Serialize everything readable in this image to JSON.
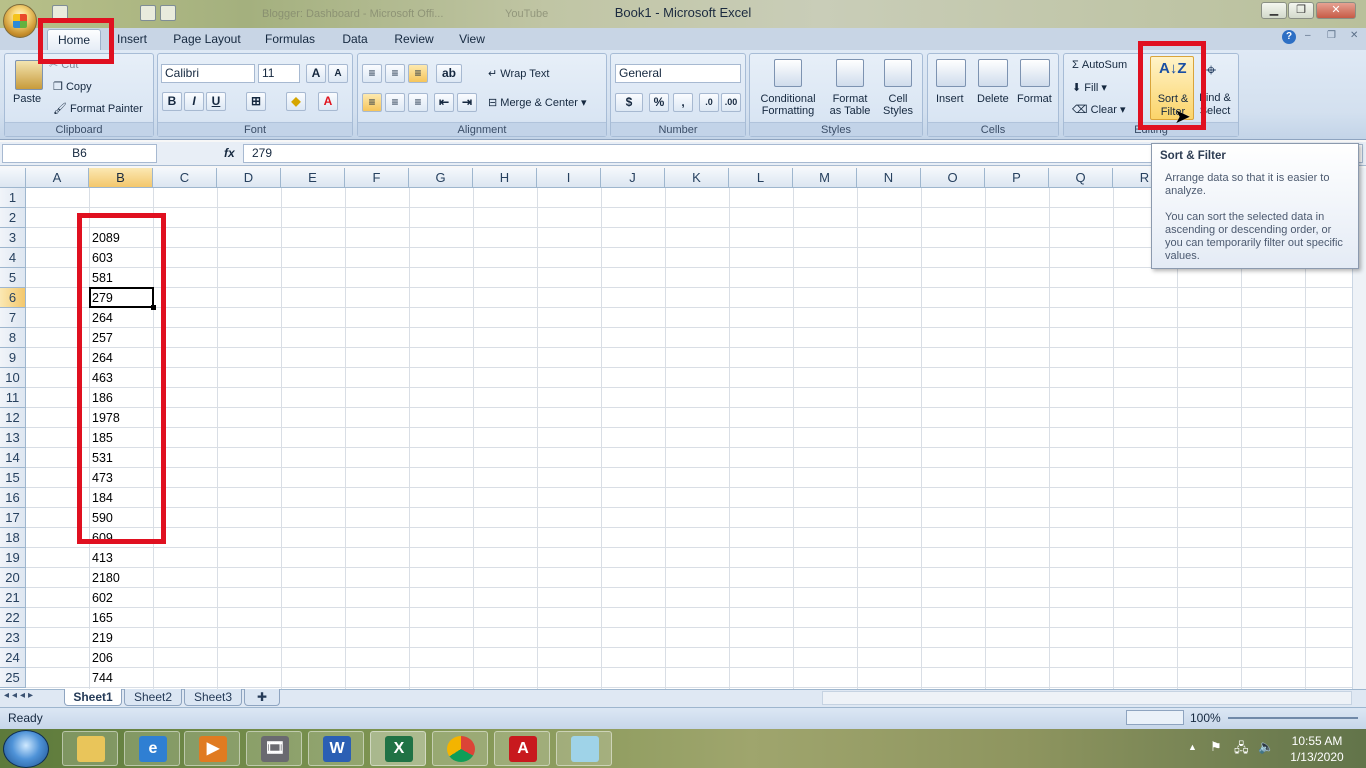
{
  "window": {
    "title": "Book1 - Microsoft Excel",
    "faint_tabs": [
      "Blogger: Dashboard - Microsoft Offi...",
      "YouTube"
    ]
  },
  "ribbon_tabs": [
    "Home",
    "Insert",
    "Page Layout",
    "Formulas",
    "Data",
    "Review",
    "View"
  ],
  "clipboard": {
    "paste": "Paste",
    "cut": "Cut",
    "copy": "Copy",
    "format_painter": "Format Painter",
    "label": "Clipboard"
  },
  "font": {
    "family": "Calibri",
    "size": "11",
    "label": "Font"
  },
  "alignment": {
    "wrap": "Wrap Text",
    "merge": "Merge & Center",
    "label": "Alignment"
  },
  "number": {
    "format": "General",
    "label": "Number"
  },
  "styles": {
    "cond1": "Conditional",
    "cond2": "Formatting",
    "table1": "Format",
    "table2": "as Table",
    "cell1": "Cell",
    "cell2": "Styles",
    "label": "Styles"
  },
  "cells": {
    "insert": "Insert",
    "delete": "Delete",
    "format": "Format",
    "label": "Cells"
  },
  "editing": {
    "autosum": "AutoSum",
    "fill": "Fill",
    "clear": "Clear",
    "sort1": "Sort &",
    "sort2": "Filter",
    "find1": "Find &",
    "find2": "Select",
    "label": "Editing"
  },
  "formula_bar": {
    "name_box": "B6",
    "fx": "fx",
    "value": "279"
  },
  "columns": [
    "A",
    "B",
    "C",
    "D",
    "E",
    "F",
    "G",
    "H",
    "I",
    "J",
    "K",
    "L",
    "M",
    "N",
    "O",
    "P",
    "Q",
    "R"
  ],
  "rows": [
    "1",
    "2",
    "3",
    "4",
    "5",
    "6",
    "7",
    "8",
    "9",
    "10",
    "11",
    "12",
    "13",
    "14",
    "15",
    "16",
    "17",
    "18",
    "19",
    "20",
    "21",
    "22",
    "23",
    "24",
    "25"
  ],
  "column_b": [
    "",
    "",
    "2089",
    "603",
    "581",
    "279",
    "264",
    "257",
    "264",
    "463",
    "186",
    "1978",
    "185",
    "531",
    "473",
    "184",
    "590",
    "609",
    "413",
    "2180",
    "602",
    "165",
    "219",
    "206",
    "744"
  ],
  "sheet_tabs": [
    "Sheet1",
    "Sheet2",
    "Sheet3"
  ],
  "status": {
    "ready": "Ready",
    "zoom": "100%"
  },
  "tooltip": {
    "title": "Sort & Filter",
    "line1": "Arrange data so that it is easier to analyze.",
    "line2": "You can sort the selected data in ascending or descending order, or you can temporarily filter out specific values."
  },
  "clock": {
    "time": "10:55 AM",
    "date": "1/13/2020"
  }
}
